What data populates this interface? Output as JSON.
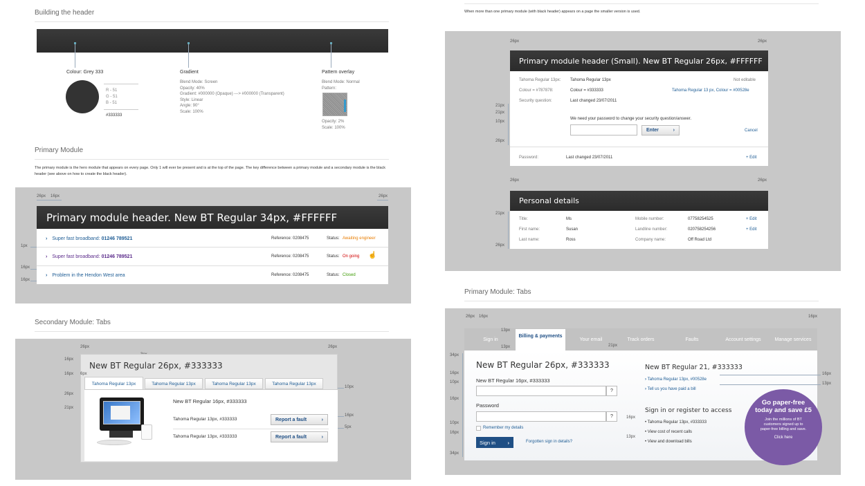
{
  "top_left": {
    "section_title": "Building the header",
    "colour": {
      "label": "Colour: Grey 333",
      "rgb": [
        "R - 51",
        "G - 51",
        "B - 51"
      ],
      "hex": "#333333"
    },
    "gradient": {
      "label": "Gradient",
      "lines": [
        "Blend Mode: Screen",
        "Opacity: 40%",
        "Gradient: #000000 (Opaque) ---> #000000 (Transparent)",
        "Style: Linear",
        "Angle: 90°",
        "Scale: 100%"
      ]
    },
    "pattern": {
      "label": "Pattern overlay",
      "lines_top": [
        "Blend Mode: Normal",
        "Pattern:"
      ],
      "lines_bottom": [
        "Opacity: 2%",
        "Scale: 100%"
      ]
    }
  },
  "primary_module": {
    "section_title": "Primary Module",
    "description": "The primary module is the hero module that appears on every page. Only 1 will ever be present and is at the top of the page. The key difference between a primary module and a secondary module is the black header (see above on how to create the black header).",
    "header": "Primary module header. New BT Regular 34px, #FFFFFF",
    "ann_top": [
      "26px",
      "16px",
      "26px"
    ],
    "ann_left": [
      "1px",
      "16px",
      "16px"
    ],
    "rows": [
      {
        "label": "Super fast broadband:",
        "number": "01246 789521",
        "reference": "Reference: 0208475",
        "status_label": "Status:",
        "status": "Awaiting engineer"
      },
      {
        "label": "Super fast broadband:",
        "number": "01246 789521",
        "reference": "Reference: 0208475",
        "status_label": "Status:",
        "status": "On going"
      },
      {
        "label": "Problem in the Hendon West area",
        "number": "",
        "reference": "Reference: 0208475",
        "status_label": "Status:",
        "status": "Closed"
      }
    ]
  },
  "secondary_tabs": {
    "section_title": "Secondary Module: Tabs",
    "heading": "New BT Regular 26px, #333333",
    "tabs": [
      "Tahoma Regular 13px",
      "Tahoma Regular 13px",
      "Tahoma Regular 13px",
      "Tahoma Regular 13px"
    ],
    "subheading": "New BT Regular 16px, #333333",
    "rows": [
      {
        "text": "Tahoma Regular 13px, #333333",
        "button": "Report a fault"
      },
      {
        "text": "Tahoma Regular 13px, #333333",
        "button": "Report a fault"
      }
    ],
    "ann_top": [
      "26px",
      "3px",
      "26px"
    ],
    "ann_left": [
      "16px",
      "16px",
      "6px",
      "26px",
      "21px"
    ],
    "ann_right": [
      "10px",
      "16px",
      "5px"
    ]
  },
  "small_header": {
    "note": "When more than one primary module (with black header) appears on a page the smaller version is used.",
    "header": "Primary module header (Small). New BT Regular 26px, #FFFFFF",
    "rows": {
      "r1_label": "Tahoma Regular 13px:",
      "r1_value": "Tahoma Regular 13px",
      "r1_right": "Not editable",
      "r2_label": "Colour = #787878:",
      "r2_value": "Colour = #333333",
      "r2_right": "Tahoma Regular 13 px, Colour = #00528e",
      "r3_label": "Security question:",
      "r3_value": "Last changed 23/07/2011",
      "prompt": "We need your password to change your security question/answer.",
      "enter": "Enter",
      "cancel": "Cancel",
      "r4_label": "Password:",
      "r4_value": "Last changed 23/07/2011",
      "r4_edit": "+ Edit"
    },
    "ann_top": [
      "26px",
      "26px"
    ],
    "ann_left": [
      "21px",
      "21px",
      "10px",
      "26px"
    ]
  },
  "personal": {
    "header": "Personal details",
    "ann_top": [
      "26px",
      "26px"
    ],
    "ann_left": [
      "21px",
      "26px"
    ],
    "rows": [
      {
        "l1": "Title:",
        "v1": "Ms",
        "l2": "Mobile number:",
        "v2": "07758254525",
        "edit": "+ Edit"
      },
      {
        "l1": "First name:",
        "v1": "Susan",
        "l2": "Landline number:",
        "v2": "020758254256",
        "edit": "+ Edit"
      },
      {
        "l1": "Last name:",
        "v1": "Ross",
        "l2": "Company name:",
        "v2": "Off Road Ltd",
        "edit": ""
      }
    ]
  },
  "primary_tabs": {
    "section_title": "Primary Module: Tabs",
    "tabs": [
      "Sign in",
      "Billing & payments",
      "Your email",
      "Track orders",
      "Faults",
      "Account settings",
      "Manage services"
    ],
    "heading_left": "New BT Regular 26px, #333333",
    "field_label": "New BT Regular 16px, #333333",
    "password_label": "Password",
    "remember": "Remember my details",
    "signin_btn": "Sign in",
    "forgotten": "Forgotten sign in details?",
    "heading_right": "New BT Regular 21, #333333",
    "links": [
      "Tahoma Regular 13px, #00528e",
      "Tell us you have paid a bill"
    ],
    "register_heading": "Sign in or register to access",
    "bullets": [
      "Tahoma Regular 13px, #333333",
      "View cost of recent calls",
      "View and download bills"
    ],
    "promo": {
      "title": "Go paper-free today and save £5",
      "body": "Join the millions of BT customers signed up to paper-free billing and save.",
      "link": "Click here"
    },
    "ann_top": [
      "26px",
      "16px",
      "16px"
    ],
    "ann_tab": [
      "13px",
      "13px",
      "21px"
    ],
    "ann_left": [
      "34px",
      "16px",
      "10px",
      "16px",
      "10px",
      "16px",
      "34px"
    ],
    "ann_right": [
      "16px",
      "13px"
    ],
    "ann_mid": [
      "16px",
      "13px"
    ]
  }
}
